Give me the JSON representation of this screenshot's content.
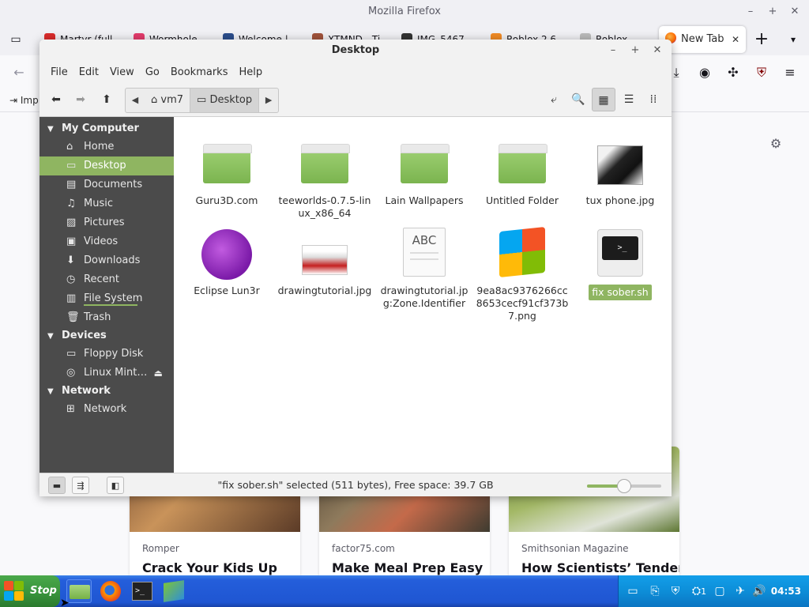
{
  "firefox": {
    "window_title": "Mozilla Firefox",
    "tabs": [
      {
        "label": "Martyr (full",
        "color": "#d92b2b"
      },
      {
        "label": "Wormhole",
        "color": "#e33b6b"
      },
      {
        "label": "Welcome |",
        "color": "#2b4d8c"
      },
      {
        "label": "XTMND - Ti",
        "color": "#a0523b"
      },
      {
        "label": "IMG_5467",
        "color": "#333333"
      },
      {
        "label": "Roblox 2.6",
        "color": "#f08a24"
      },
      {
        "label": "Roblox",
        "color": "#bbbbbb"
      }
    ],
    "active_tab": "New Tab",
    "bookmarks_first": "Imp",
    "cards": [
      {
        "source": "Romper",
        "title": "Crack Your Kids Up"
      },
      {
        "source": "factor75.com",
        "title": "Make Meal Prep Easy"
      },
      {
        "source": "Smithsonian Magazine",
        "title": "How Scientists’ Tender"
      }
    ]
  },
  "nemo": {
    "title": "Desktop",
    "menu": [
      "File",
      "Edit",
      "View",
      "Go",
      "Bookmarks",
      "Help"
    ],
    "path": {
      "home": "vm7",
      "current": "Desktop"
    },
    "sidebar": {
      "sections": [
        {
          "label": "My Computer",
          "items": [
            {
              "label": "Home",
              "icon": "home-icon"
            },
            {
              "label": "Desktop",
              "icon": "desktop-icon",
              "selected": true
            },
            {
              "label": "Documents",
              "icon": "documents-icon"
            },
            {
              "label": "Music",
              "icon": "music-icon"
            },
            {
              "label": "Pictures",
              "icon": "pictures-icon"
            },
            {
              "label": "Videos",
              "icon": "videos-icon"
            },
            {
              "label": "Downloads",
              "icon": "downloads-icon"
            },
            {
              "label": "Recent",
              "icon": "recent-icon"
            },
            {
              "label": "File System",
              "icon": "filesystem-icon"
            },
            {
              "label": "Trash",
              "icon": "trash-icon"
            }
          ]
        },
        {
          "label": "Devices",
          "items": [
            {
              "label": "Floppy Disk",
              "icon": "floppy-icon"
            },
            {
              "label": "Linux Mint…",
              "icon": "disc-icon"
            }
          ]
        },
        {
          "label": "Network",
          "items": [
            {
              "label": "Network",
              "icon": "network-icon"
            }
          ]
        }
      ]
    },
    "files": [
      {
        "name": "Guru3D.com",
        "type": "folder"
      },
      {
        "name": "teeworlds-0.7.5-linux_x86_64",
        "type": "folder"
      },
      {
        "name": "Lain Wallpapers",
        "type": "folder"
      },
      {
        "name": "Untitled Folder",
        "type": "folder"
      },
      {
        "name": "tux phone.jpg",
        "type": "image"
      },
      {
        "name": "Eclipse Lun3r",
        "type": "image"
      },
      {
        "name": "drawingtutorial.jpg",
        "type": "image"
      },
      {
        "name": "drawingtutorial.jpg:Zone.Identifier",
        "type": "text"
      },
      {
        "name": "9ea8ac9376266cc8653cecf91cf373b7.png",
        "type": "image"
      },
      {
        "name": "fix sober.sh",
        "type": "script",
        "selected": true
      }
    ],
    "status": "\"fix sober.sh\" selected (511 bytes), Free space: 39.7 GB",
    "zoom_level": 0.5,
    "filesystem_usage": 0.75
  },
  "taskbar": {
    "start_label": "Stop",
    "clock": "04:53",
    "tray_badge": "1"
  }
}
